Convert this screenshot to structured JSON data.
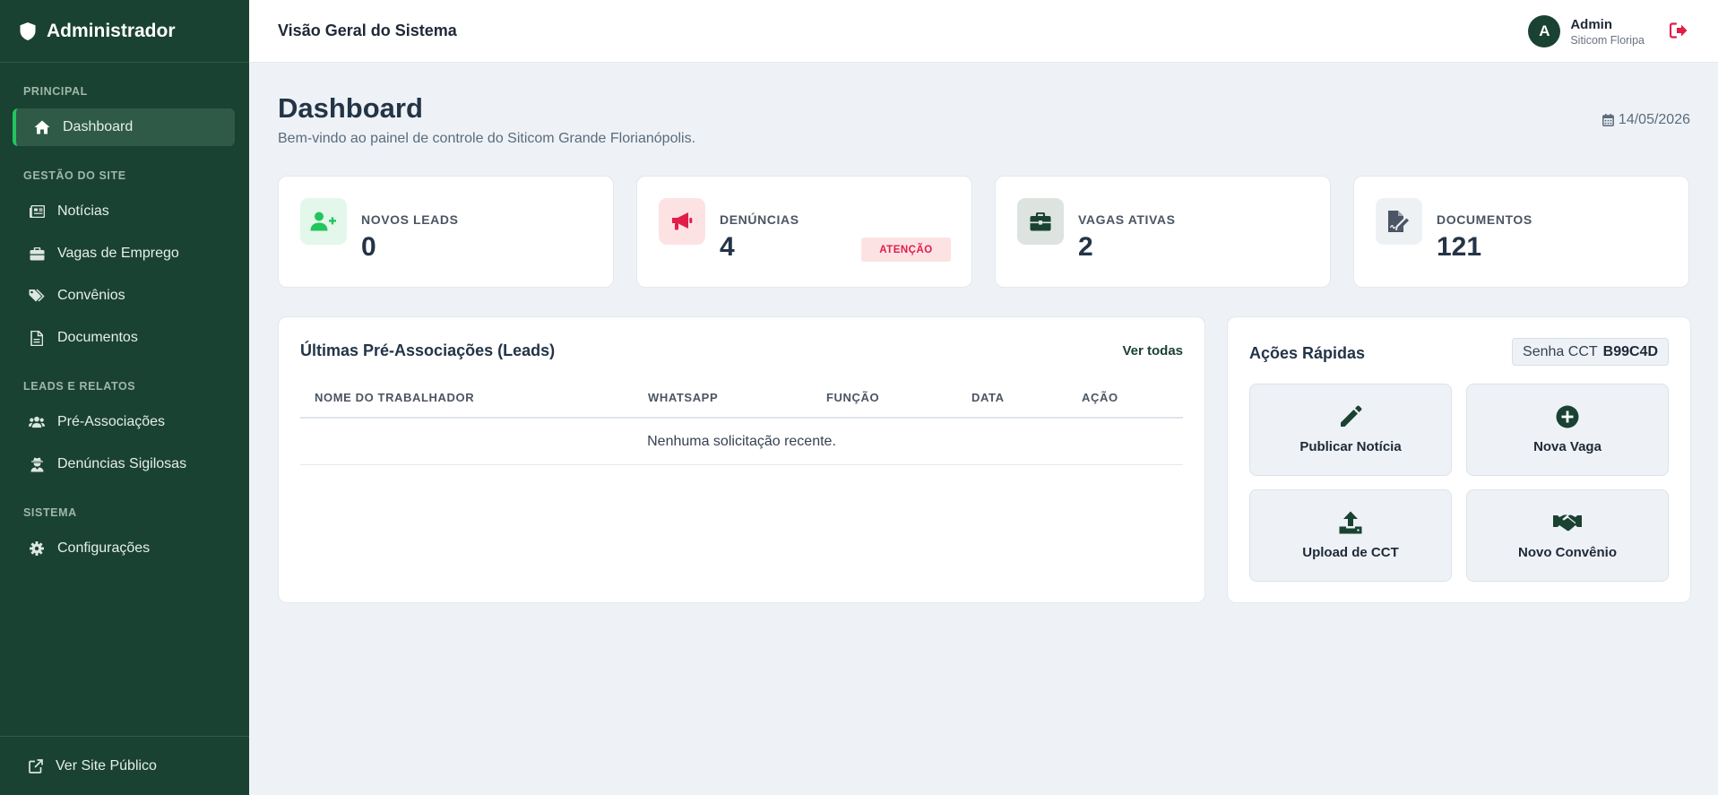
{
  "sidebar": {
    "brand": "Administrador",
    "sections": [
      {
        "title": "PRINCIPAL"
      },
      {
        "title": "GESTÃO DO SITE"
      },
      {
        "title": "LEADS E RELATOS"
      },
      {
        "title": "SISTEMA"
      }
    ],
    "items": [
      {
        "label": "Dashboard",
        "icon": "home-icon"
      },
      {
        "label": "Notícias",
        "icon": "newspaper-icon"
      },
      {
        "label": "Vagas de Emprego",
        "icon": "briefcase-icon"
      },
      {
        "label": "Convênios",
        "icon": "tags-icon"
      },
      {
        "label": "Documentos",
        "icon": "file-icon"
      },
      {
        "label": "Pré-Associações",
        "icon": "users-icon"
      },
      {
        "label": "Denúncias Sigilosas",
        "icon": "user-secret-icon"
      },
      {
        "label": "Configurações",
        "icon": "gear-icon"
      }
    ],
    "footer": "Ver Site Público"
  },
  "header": {
    "title": "Visão Geral do Sistema",
    "user": {
      "initial": "A",
      "name": "Admin",
      "org": "Siticom Floripa"
    }
  },
  "page": {
    "title": "Dashboard",
    "subtitle": "Bem-vindo ao painel de controle do Siticom Grande Florianópolis.",
    "date": "14/05/2026"
  },
  "stats": [
    {
      "label": "NOVOS LEADS",
      "value": "0",
      "icon": "user-plus-icon",
      "color": "#22c55e"
    },
    {
      "label": "DENÚNCIAS",
      "value": "4",
      "icon": "megaphone-icon",
      "color": "#e11d48",
      "badge": "ATENÇÃO"
    },
    {
      "label": "VAGAS ATIVAS",
      "value": "2",
      "icon": "briefcase-icon",
      "color": "#1a4232"
    },
    {
      "label": "DOCUMENTOS",
      "value": "121",
      "icon": "file-signature-icon",
      "color": "#4b5563"
    }
  ],
  "leads": {
    "title": "Últimas Pré-Associações (Leads)",
    "link": "Ver todas",
    "columns": [
      "NOME DO TRABALHADOR",
      "WHATSAPP",
      "FUNÇÃO",
      "DATA",
      "AÇÃO"
    ],
    "empty": "Nenhuma solicitação recente."
  },
  "quick": {
    "title": "Ações Rápidas",
    "senha_label": "Senha CCT",
    "senha_value": "B99C4D",
    "actions": [
      {
        "label": "Publicar Notícia",
        "icon": "pencil-icon"
      },
      {
        "label": "Nova Vaga",
        "icon": "plus-circle-icon"
      },
      {
        "label": "Upload de CCT",
        "icon": "upload-icon"
      },
      {
        "label": "Novo Convênio",
        "icon": "handshake-icon"
      }
    ]
  },
  "colors": {
    "sidebar": "#1a4232",
    "accent": "#22c55e",
    "danger": "#e11d48",
    "background": "#eef2f6"
  }
}
